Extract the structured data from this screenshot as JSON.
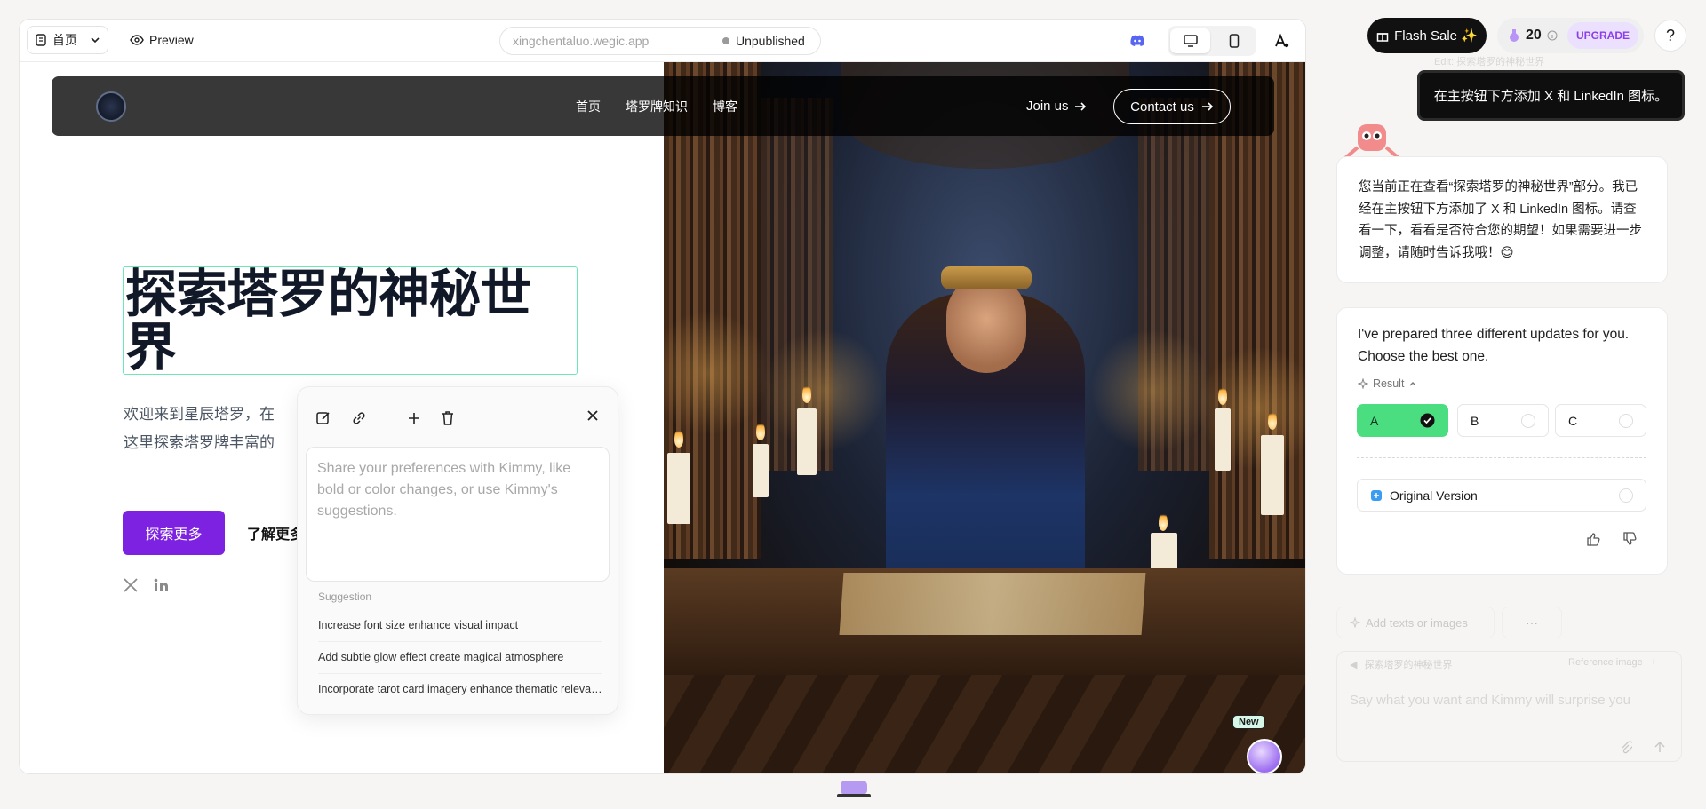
{
  "topbar": {
    "page_select": "首页",
    "preview_label": "Preview",
    "url": "xingchentaluo.wegic.app",
    "publish_status": "Unpublished"
  },
  "site": {
    "nav": {
      "links": [
        "首页",
        "塔罗牌知识",
        "博客"
      ],
      "join_label": "Join us",
      "contact_label": "Contact us"
    },
    "hero": {
      "title": "探索塔罗的神秘世界",
      "description": "欢迎来到星辰塔罗，在这里探索塔罗牌丰富的知识与故事。",
      "primary_cta": "探索更多",
      "secondary_cta": "了解更多"
    },
    "new_badge": "New"
  },
  "edit_popover": {
    "placeholder": "Share your preferences with Kimmy, like bold or color changes, or use Kimmy's suggestions.",
    "suggestion_title": "Suggestion",
    "suggestions": [
      "Increase font size enhance visual impact",
      "Add subtle glow effect create magical atmosphere",
      "Incorporate tarot card imagery enhance thematic relevance"
    ]
  },
  "right_panel": {
    "flash_sale": "Flash Sale ✨",
    "credits": "20",
    "upgrade": "UPGRADE",
    "help": "?",
    "faded_header": "Edit: 探索塔罗的神秘世界",
    "user_message": "在主按钮下方添加 X 和 LinkedIn 图标。",
    "assistant_message": "您当前正在查看“探索塔罗的神秘世界”部分。我已经在主按钮下方添加了 X 和 LinkedIn 图标。请查看一下，看看是否符合您的期望！如果需要进一步调整，请随时告诉我哦！😊",
    "updates_message": "I've prepared three different updates for you. Choose the best one.",
    "result_label": "Result",
    "options": [
      "A",
      "B",
      "C"
    ],
    "selected_option": "A",
    "original_version": "Original Version",
    "composer": {
      "add_label": "Add texts or images",
      "more": "···",
      "context": "探索塔罗的神秘世界",
      "reference": "Reference image",
      "placeholder": "Say what you want and Kimmy will surprise you"
    }
  },
  "colors": {
    "accent_purple": "#7c22e0",
    "selection_green": "#6ee7b7",
    "option_selected": "#4ade80"
  }
}
